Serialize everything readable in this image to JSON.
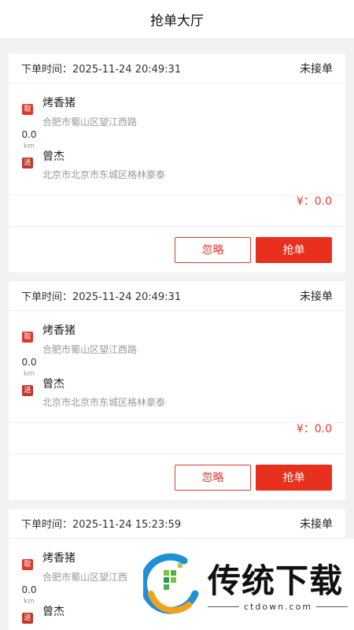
{
  "header": {
    "title": "抢单大厅"
  },
  "orders": [
    {
      "time_label": "下单时间：",
      "time": "2025-11-24 20:49:31",
      "status": "未接单",
      "pickup_tag": "取",
      "delivery_tag": "送",
      "distance": "0.0",
      "distance_unit": "km",
      "pickup_name": "烤香猪",
      "pickup_address": "合肥市蜀山区望江西路",
      "delivery_name": "曾杰",
      "delivery_address": "北京市北京市东城区格林豪泰",
      "price": "¥：0.0",
      "ignore_label": "忽略",
      "grab_label": "抢单"
    },
    {
      "time_label": "下单时间：",
      "time": "2025-11-24 20:49:31",
      "status": "未接单",
      "pickup_tag": "取",
      "delivery_tag": "送",
      "distance": "0.0",
      "distance_unit": "km",
      "pickup_name": "烤香猪",
      "pickup_address": "合肥市蜀山区望江西路",
      "delivery_name": "曾杰",
      "delivery_address": "北京市北京市东城区格林豪泰",
      "price": "¥：0.0",
      "ignore_label": "忽略",
      "grab_label": "抢单"
    },
    {
      "time_label": "下单时间：",
      "time": "2025-11-24 15:23:59",
      "status": "未接单",
      "pickup_tag": "取",
      "delivery_tag": "送",
      "distance": "0.0",
      "distance_unit": "km",
      "pickup_name": "烤香猪",
      "pickup_address": "合肥市蜀山区望江西",
      "delivery_name": "曾杰",
      "delivery_address": "",
      "price": "",
      "ignore_label": "",
      "grab_label": ""
    }
  ],
  "watermark": {
    "brand": "传统下载",
    "url": "ctdown.com"
  },
  "colors": {
    "accent": "#e8301f",
    "background": "#f2f2f2"
  }
}
